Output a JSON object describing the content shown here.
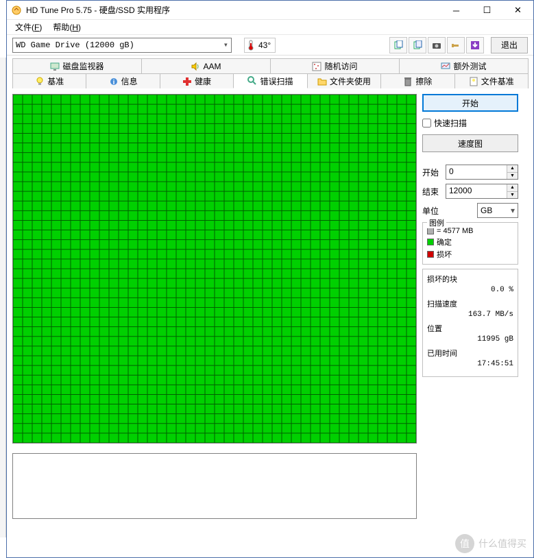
{
  "window": {
    "title": "HD Tune Pro 5.75 - 硬盘/SSD 实用程序"
  },
  "menu": {
    "file": "文件(F)",
    "help": "帮助(H)"
  },
  "toolbar": {
    "drive": "WD    Game Drive (12000 gB)",
    "temperature": "43°",
    "exit_label": "退出"
  },
  "tabs": {
    "row1": [
      {
        "label": "磁盘监视器",
        "icon": "monitor-icon"
      },
      {
        "label": "AAM",
        "icon": "speaker-icon"
      },
      {
        "label": "随机访问",
        "icon": "random-icon"
      },
      {
        "label": "额外测试",
        "icon": "extra-icon"
      }
    ],
    "row2": [
      {
        "label": "基准",
        "icon": "bulb-icon"
      },
      {
        "label": "信息",
        "icon": "info-icon"
      },
      {
        "label": "健康",
        "icon": "health-icon"
      },
      {
        "label": "错误扫描",
        "icon": "search-icon",
        "active": true
      },
      {
        "label": "文件夹使用",
        "icon": "folder-icon"
      },
      {
        "label": "擦除",
        "icon": "trash-icon"
      },
      {
        "label": "文件基准",
        "icon": "filebench-icon"
      }
    ]
  },
  "panel": {
    "start_button": "开始",
    "quick_scan": "快速扫描",
    "speed_chart": "速度图",
    "start_label": "开始",
    "start_value": "0",
    "end_label": "结束",
    "end_value": "12000",
    "unit_label": "单位",
    "unit_value": "GB"
  },
  "legend": {
    "title": "图例",
    "block_size": "= 4577 MB",
    "ok": "确定",
    "damaged": "损坏"
  },
  "stats": {
    "damaged_blocks_label": "损坏的块",
    "damaged_blocks_value": "0.0 %",
    "scan_speed_label": "扫描速度",
    "scan_speed_value": "163.7 MB/s",
    "position_label": "位置",
    "position_value": "11995 gB",
    "elapsed_label": "已用时间",
    "elapsed_value": "17:45:51"
  },
  "watermark": {
    "text": "什么值得买",
    "badge": "值"
  },
  "scan_grid": {
    "cols": 42,
    "rows": 36,
    "cell_color": "#00d000"
  }
}
